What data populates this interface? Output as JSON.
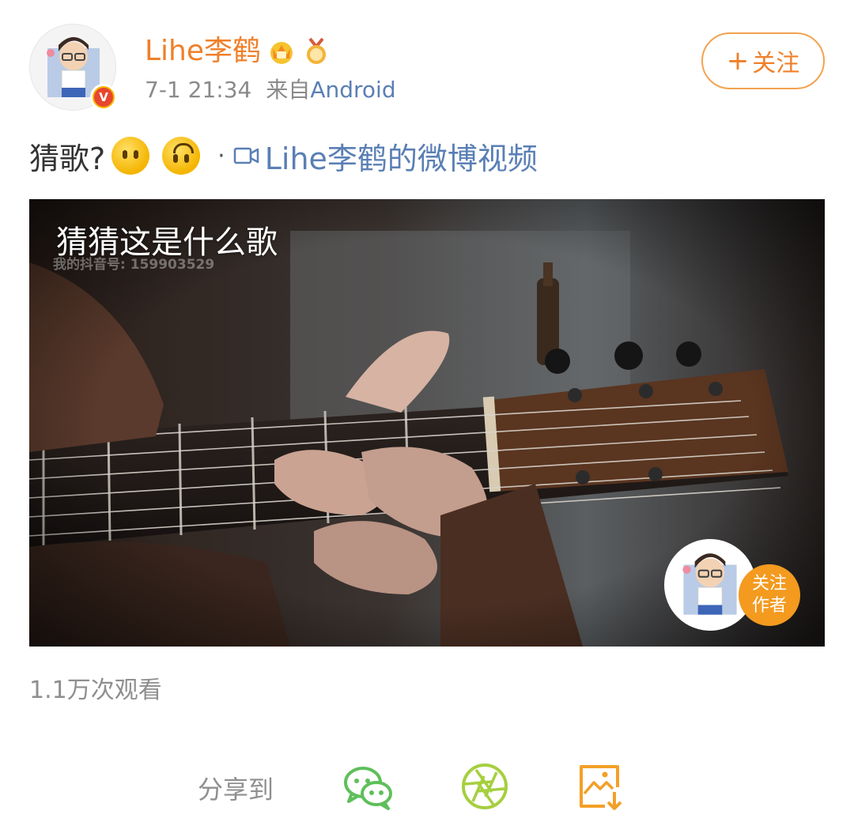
{
  "header": {
    "username": "Lihe李鹤",
    "time": "7-1 21:34",
    "source_prefix": "来自",
    "source": "Android",
    "follow_label": "关注",
    "follow_plus": "+",
    "verified_mark": "V",
    "badges": [
      "crown-vip-icon",
      "medal-icon"
    ]
  },
  "post": {
    "text": "猜歌?",
    "emojis": [
      "neutral-face-emoji",
      "upside-down-face-emoji"
    ],
    "separator": "·",
    "video_link": "Lihe李鹤的微博视频"
  },
  "video": {
    "overlay_title": "猜猜这是什么歌",
    "watermark": "我的抖音号: 159903529",
    "follow_author_line1": "关注",
    "follow_author_line2": "作者"
  },
  "stats": {
    "views": "1.1万次观看"
  },
  "share": {
    "label": "分享到",
    "targets": [
      "wechat-icon",
      "moments-icon",
      "save-image-icon"
    ]
  },
  "colors": {
    "accent_orange": "#f07f29",
    "link_blue": "#5a7fb5",
    "wechat_green": "#5fbf5b",
    "moments_green": "#a6cf3f",
    "save_orange": "#f3a028"
  }
}
